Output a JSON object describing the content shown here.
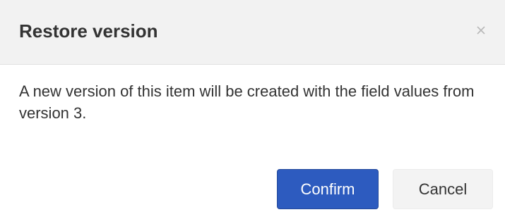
{
  "dialog": {
    "title": "Restore version",
    "close_icon": "close-icon",
    "message": "A new version of this item will be created with the field values from version 3.",
    "confirm_label": "Confirm",
    "cancel_label": "Cancel"
  },
  "colors": {
    "header_background": "#f2f2f2",
    "confirm_background": "#2d5bbf",
    "cancel_background": "#f3f3f3",
    "text": "#333333"
  }
}
